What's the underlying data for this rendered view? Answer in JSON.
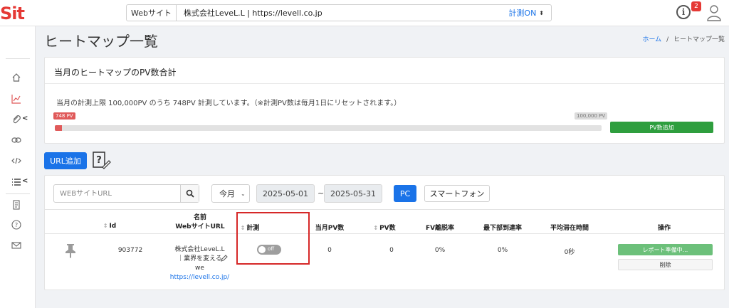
{
  "colors": {
    "brand_red": "#e53935",
    "primary": "#1a73e8",
    "success": "#2e9e3e",
    "highlight": "#d62828"
  },
  "header": {
    "logo_prefix": "S",
    "logo_rest": "it",
    "site_label": "Webサイト",
    "site_name": "株式会社LeveL.L | https://levell.co.jp",
    "measure_status": "計測ON",
    "caret": "⬍",
    "info_symbol": "i",
    "notification_count": "2"
  },
  "sidebar": {
    "icons": [
      "home-icon",
      "chart-icon",
      "clip-icon",
      "link-icon",
      "code-icon",
      "list-icon",
      "document-icon",
      "help-circle-icon",
      "mail-icon"
    ],
    "chevron": "<"
  },
  "page": {
    "title": "ヒートマップ一覧",
    "breadcrumb_home": "ホーム",
    "breadcrumb_sep": "/",
    "breadcrumb_current": "ヒートマップ一覧"
  },
  "pv_card": {
    "title": "当月のヒートマップのPV数合計",
    "description": "当月の計測上限 100,000PV のうち 748PV 計測しています。（※計測PV数は毎月1日にリセットされます。）",
    "current_label": "748 PV",
    "max_label": "100,000 PV",
    "progress_fraction": 0.00748,
    "add_button": "PV数追加"
  },
  "toolbar": {
    "url_add": "URL追加"
  },
  "filters": {
    "search_placeholder": "WEBサイトURL",
    "period": "今月",
    "period_chevron": "⌄",
    "date_from": "2025-05-01",
    "tilde": "~",
    "date_to": "2025-05-31",
    "device_pc": "PC",
    "device_sp": "スマートフォン"
  },
  "table": {
    "headers": {
      "id": "Id",
      "name_line1": "名前",
      "name_line2": "WebサイトURL",
      "measure": "計測",
      "monthly_pv": "当月PV数",
      "pv": "PV数",
      "fv_bounce": "FV離脱率",
      "bottom_reach": "最下部到達率",
      "avg_stay": "平均滞在時間",
      "actions": "操作"
    },
    "sort_glyph": "↕",
    "rows": [
      {
        "id": "903772",
        "name_line1": "株式会社LeveL.L",
        "name_line2": "｜業界を変える",
        "name_line3": "we",
        "url": "https://levell.co.jp/",
        "toggle_label": "off",
        "monthly_pv": "0",
        "pv": "0",
        "fv_bounce": "0%",
        "bottom_reach": "0%",
        "avg_stay": "0秒",
        "report_button": "レポート準備中...",
        "delete_button": "削除"
      }
    ]
  }
}
